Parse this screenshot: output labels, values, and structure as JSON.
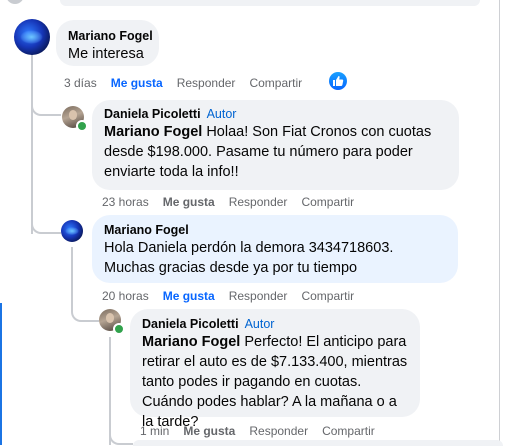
{
  "comments": [
    {
      "author": "Mariano Fogel",
      "text": "Me interesa",
      "time": "3 días",
      "like_label": "Me gusta",
      "reply_label": "Responder",
      "share_label": "Compartir",
      "liked": true
    },
    {
      "author": "Daniela Picoletti",
      "badge": "Autor",
      "mention": "Mariano Fogel",
      "text": "Holaa! Son Fiat Cronos con cuotas desde $198.000. Pasame tu número para poder enviarte toda la info!!",
      "time": "23 horas",
      "like_label": "Me gusta",
      "reply_label": "Responder",
      "share_label": "Compartir"
    },
    {
      "author": "Mariano Fogel",
      "text": "Hola Daniela perdón la demora 3434718603. Muchas gracias desde ya por tu tiempo",
      "time": "20 horas",
      "like_label": "Me gusta",
      "reply_label": "Responder",
      "share_label": "Compartir",
      "liked": true
    },
    {
      "author": "Daniela Picoletti",
      "badge": "Autor",
      "mention": "Mariano Fogel",
      "text": "Perfecto! El anticipo para retirar el auto es de $7.133.400, mientras tanto podes ir pagando en cuotas. Cuándo podes hablar? A la mañana o a la tarde?",
      "time": "1 min",
      "like_label": "Me gusta",
      "reply_label": "Responder",
      "share_label": "Compartir"
    }
  ],
  "colors": {
    "bubble": "#f0f2f5",
    "bubble_highlight": "#eaf3ff",
    "link_blue": "#0866ff",
    "meta_gray": "#65676b",
    "online_green": "#31a24c"
  },
  "icons": {
    "reaction": "thumbs-up-icon"
  }
}
